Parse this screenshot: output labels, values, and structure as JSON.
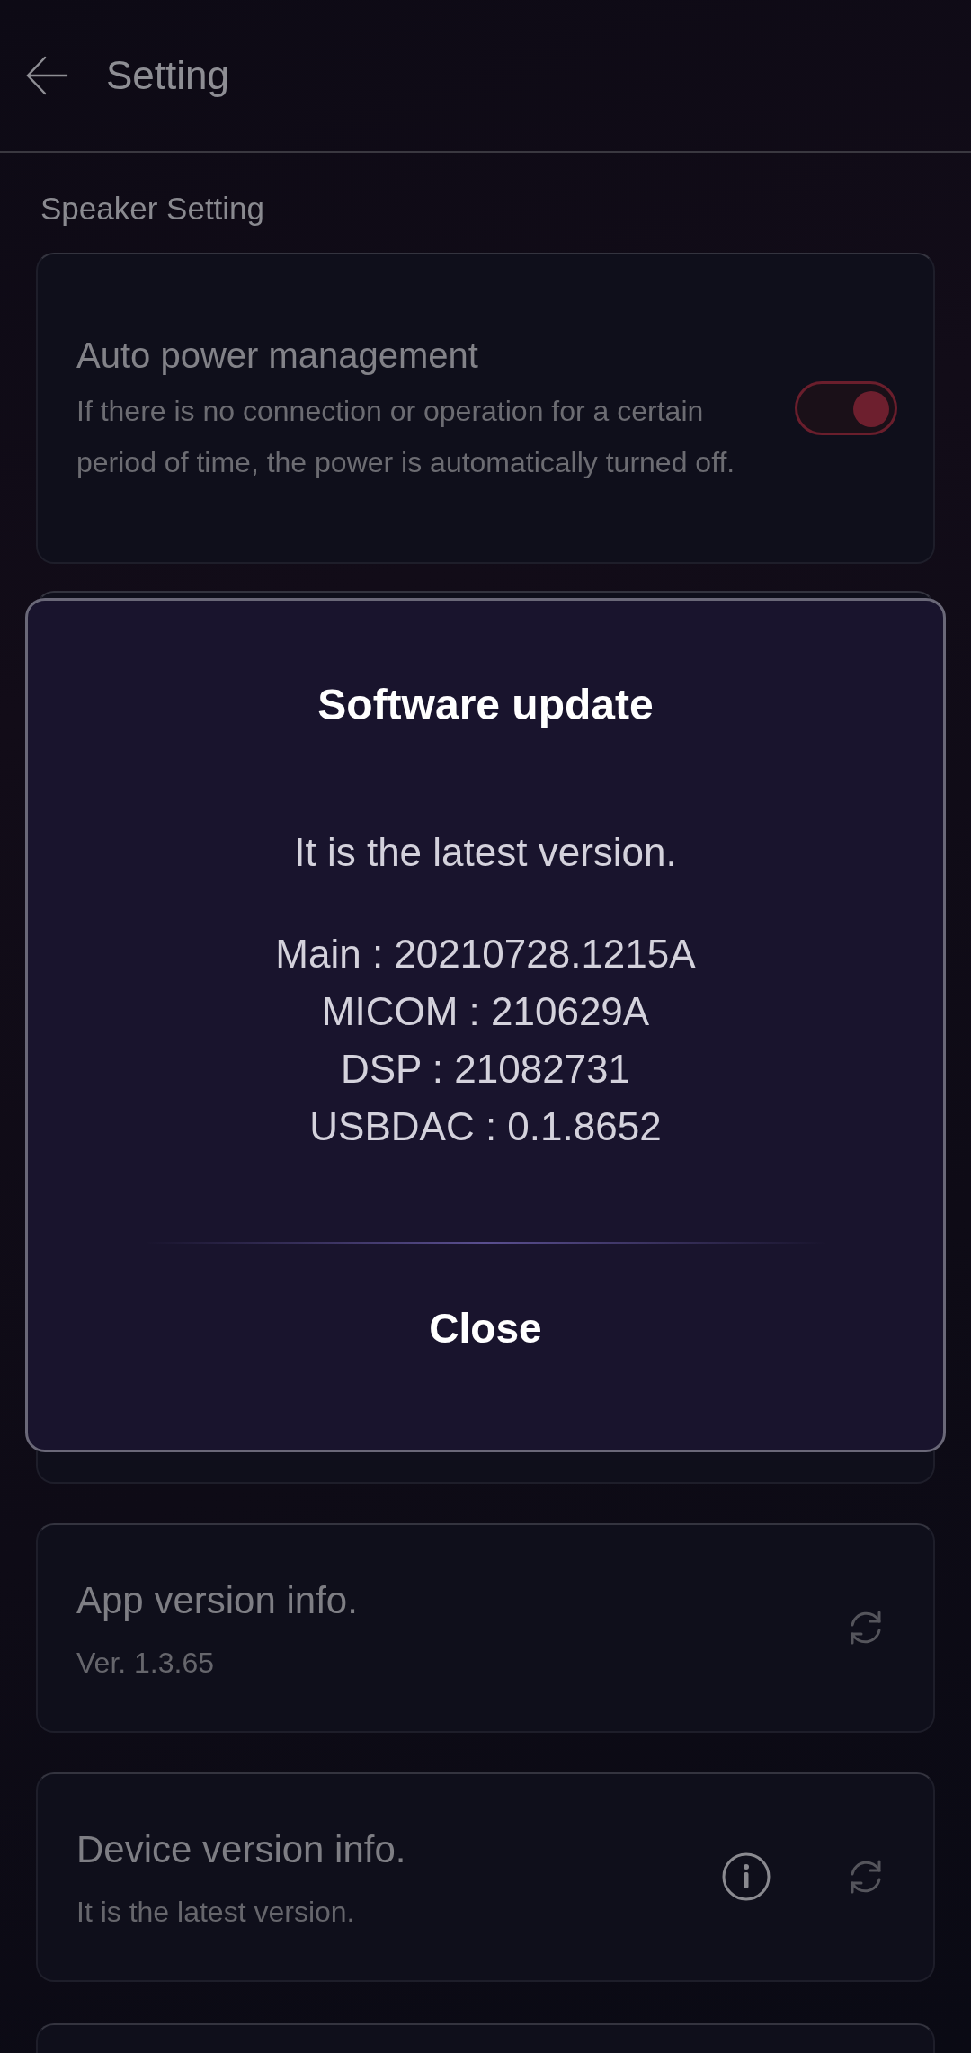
{
  "header": {
    "title": "Setting"
  },
  "section": {
    "title": "Speaker Setting"
  },
  "settings": [
    {
      "kind": "toggle",
      "title": "Auto power management",
      "description": "If there is no connection or operation for a certain period of time, the power is automatically turned off.",
      "on": true
    }
  ],
  "version_items": [
    {
      "title": "App version info.",
      "subtitle": "Ver. 1.3.65",
      "info": false
    },
    {
      "title": "Device version info.",
      "subtitle": "It is the latest version.",
      "info": true
    }
  ],
  "dialog": {
    "title": "Software update",
    "message": "It is the latest version.",
    "versions": [
      "Main : 20210728.1215A",
      "MICOM : 210629A",
      "DSP : 21082731",
      "USBDAC : 0.1.8652"
    ],
    "button": "Close"
  }
}
